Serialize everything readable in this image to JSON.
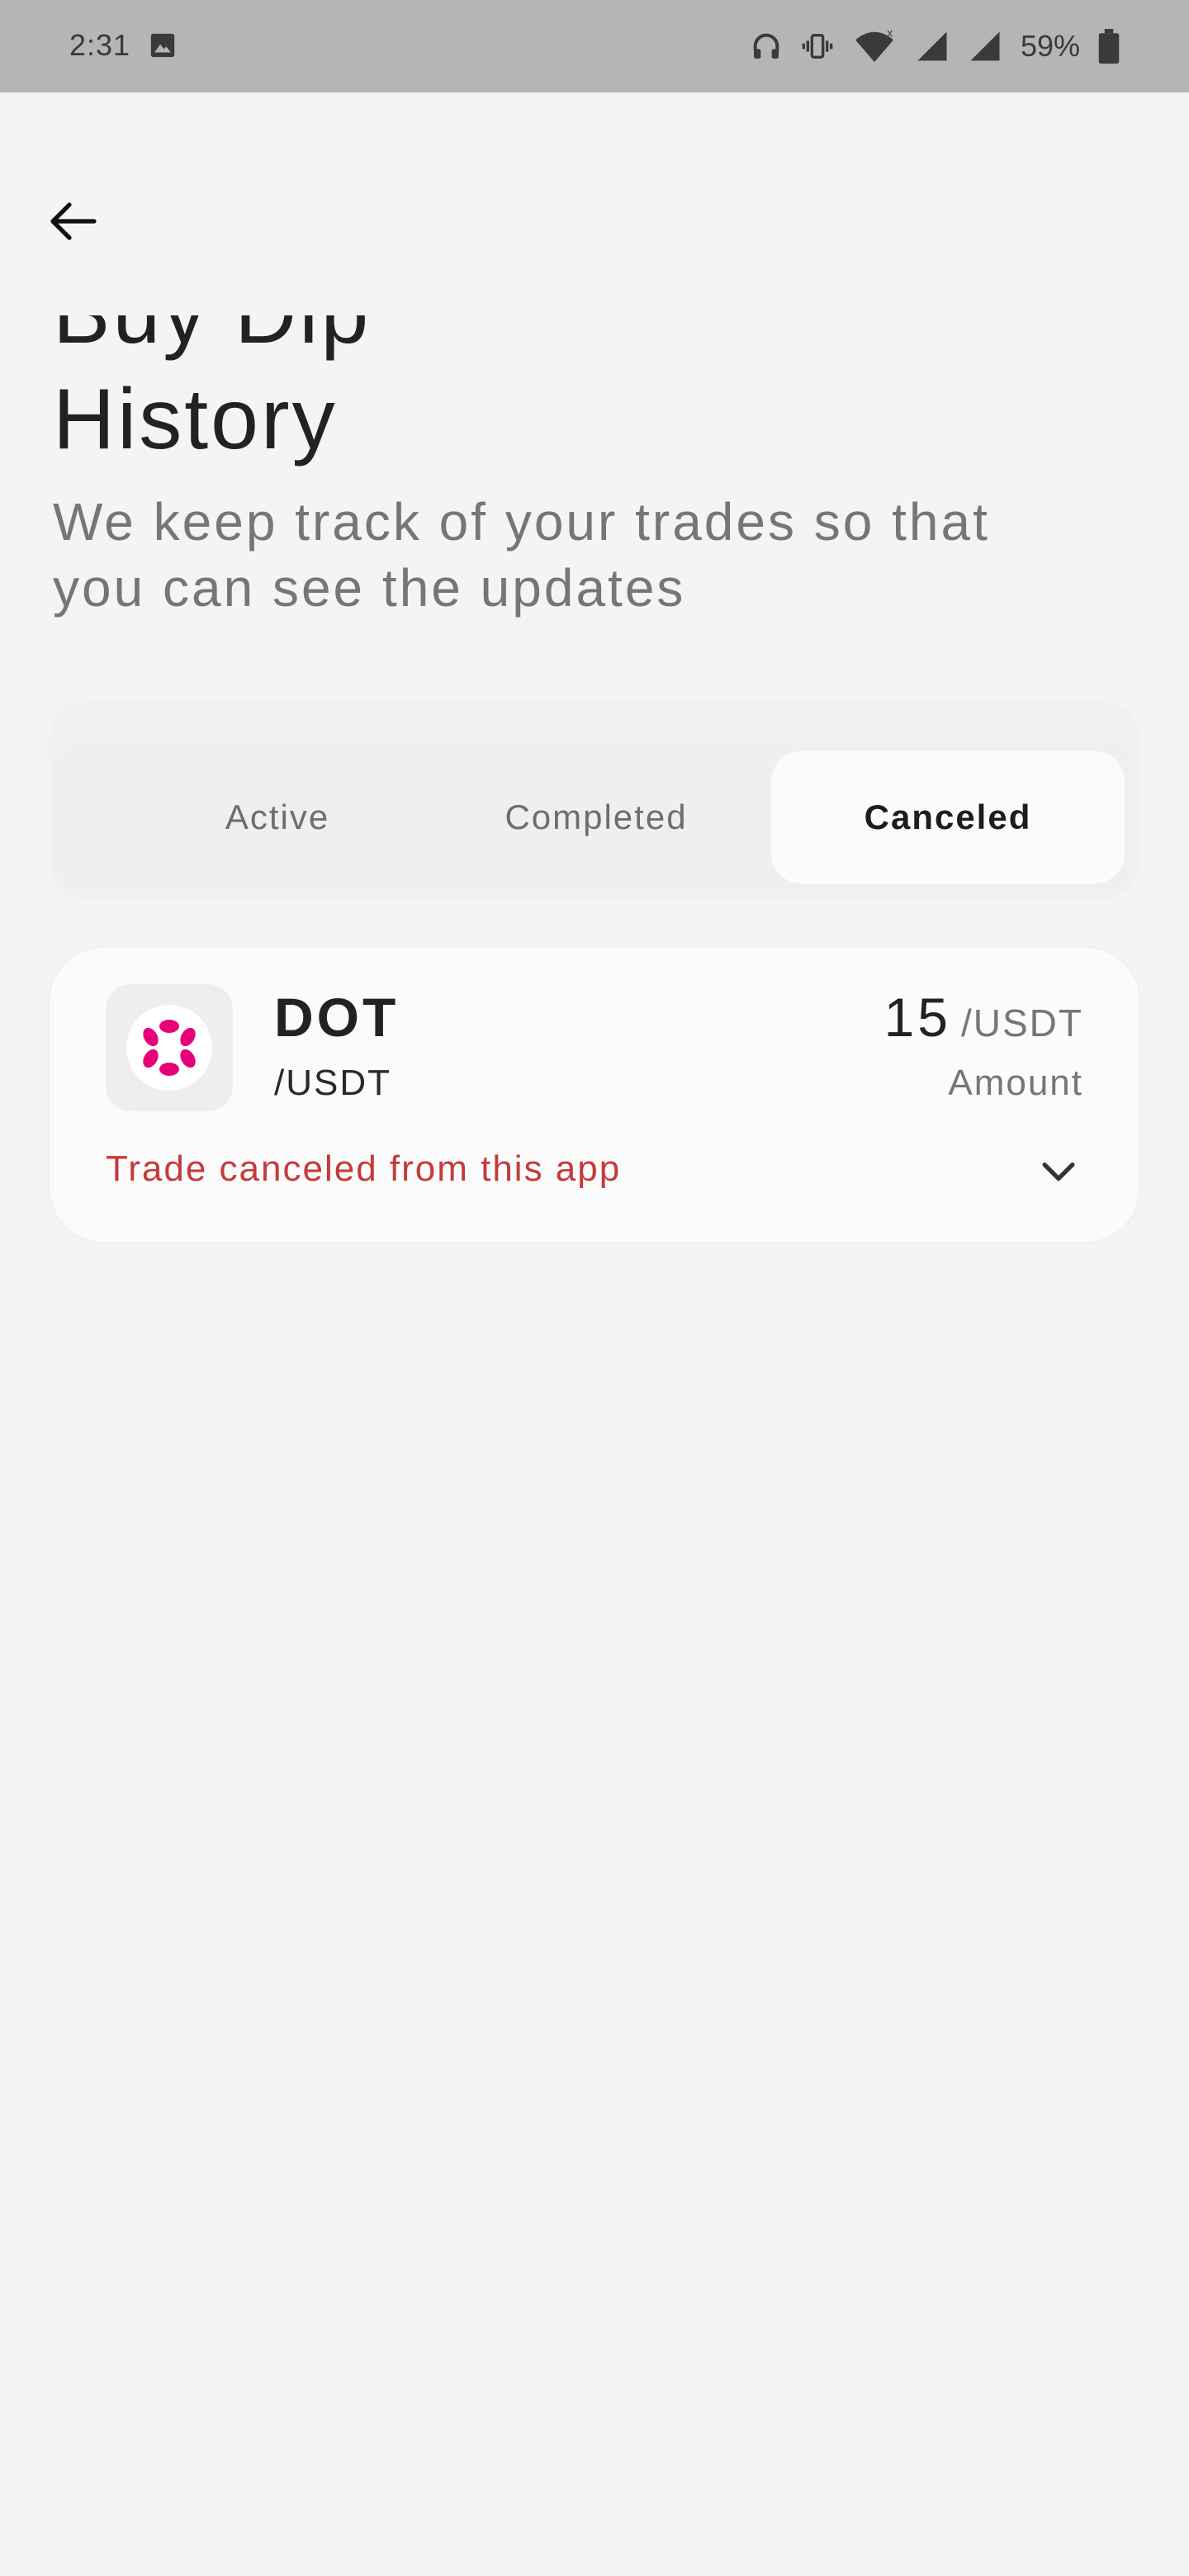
{
  "status_bar": {
    "time": "2:31",
    "battery": "59%",
    "icons": [
      "gallery-icon",
      "headphones-icon",
      "vibrate-icon",
      "wifi-icon",
      "signal-icon",
      "signal-icon",
      "battery-icon"
    ]
  },
  "header": {
    "back_icon": "arrow-left-icon",
    "title_partial": "Buy Dip",
    "title": "History",
    "subtitle": "We keep track of your trades so that you can see the updates"
  },
  "tabs": [
    {
      "label": "Active",
      "selected": false
    },
    {
      "label": "Completed",
      "selected": false
    },
    {
      "label": "Canceled",
      "selected": true
    }
  ],
  "trades": [
    {
      "symbol": "DOT",
      "quote": "/USDT",
      "amount": "15",
      "amount_unit": "/USDT",
      "amount_label": "Amount",
      "status": "Trade canceled from this app",
      "icon": "polkadot-logo",
      "expand_icon": "chevron-down-icon"
    }
  ],
  "colors": {
    "background": "#f4f4f4",
    "status_bar": "#b5b5b5",
    "card": "#fbfbfb",
    "canceled_text": "#c63a3a",
    "polkadot_pink": "#e6007a"
  }
}
